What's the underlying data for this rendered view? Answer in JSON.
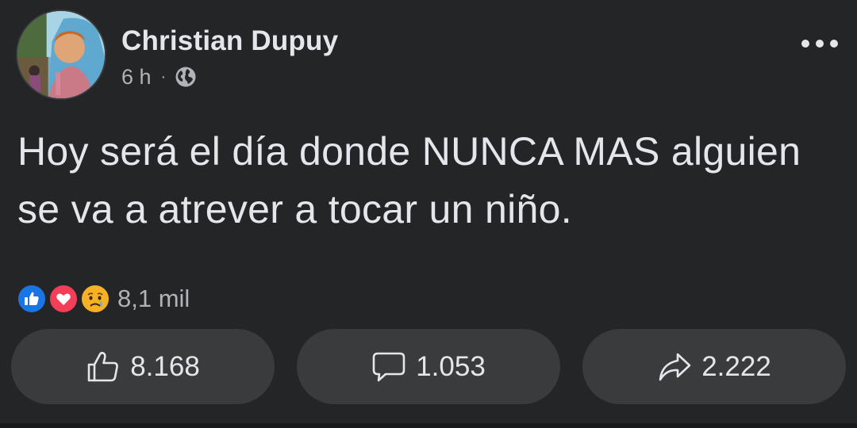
{
  "post": {
    "author": "Christian Dupuy",
    "timestamp": "6 h",
    "separator": "·",
    "audience_icon": "globe-icon",
    "more_icon": "more-horizontal-icon",
    "text": "Hoy será el día donde NUNCA MAS alguien se va a atrever a tocar un niño."
  },
  "reactions": {
    "icons": [
      "like-reaction-icon",
      "love-reaction-icon",
      "sad-reaction-icon"
    ],
    "count": "8,1 mil"
  },
  "actions": [
    {
      "icon": "like-outline-icon",
      "label": "8.168"
    },
    {
      "icon": "comment-icon",
      "label": "1.053"
    },
    {
      "icon": "share-icon",
      "label": "2.222"
    }
  ],
  "colors": {
    "background": "#242526",
    "button_bg": "#3a3b3c",
    "text_primary": "#e4e6eb",
    "text_secondary": "#b0b3b8",
    "like_blue": "#1b74e4",
    "love_red": "#f33e58",
    "sad_yellow": "#f7b125"
  }
}
